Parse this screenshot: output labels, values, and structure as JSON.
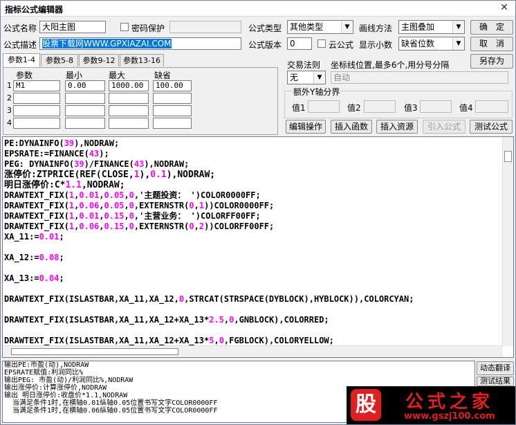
{
  "window": {
    "title": "指标公式编辑器",
    "close_glyph": "✕"
  },
  "form": {
    "name_label": "公式名称",
    "name_value": "大阳主图",
    "password_label": "密码保护",
    "password_value": "",
    "desc_label": "公式描述",
    "desc_value": "股票下载网WWW.GPXIAZAI.COM",
    "type_label": "公式类型",
    "type_value": "其他类型",
    "draw_label": "画线方法",
    "draw_value": "主图叠加",
    "version_label": "公式版本",
    "version_value": "0",
    "cloud_label": "云公式",
    "decimal_label": "显示小数",
    "decimal_value": "缺省位数",
    "trade_label": "交易法则",
    "trade_value": "无",
    "coord_label": "坐标线位置,最多6个,用分号分隔",
    "coord_value": "自动",
    "extra_y_label": "额外Y轴分界",
    "y_labels": [
      "值1",
      "值2",
      "值3",
      "值4"
    ]
  },
  "buttons": {
    "ok": "确　定",
    "cancel": "取　消",
    "save_as": "另存为",
    "edit_op": "编辑操作",
    "insert_func": "插入函数",
    "insert_res": "插入资源",
    "import_formula": "引入公式",
    "test_formula": "测试公式",
    "dyn_translate": "动态翻译",
    "test_result": "测试结果"
  },
  "tabs": [
    "参数1-4",
    "参数5-8",
    "参数9-12",
    "参数13-16"
  ],
  "params": {
    "headers": [
      "参数",
      "最小",
      "最大",
      "缺省"
    ],
    "rows": [
      {
        "idx": "1",
        "name": "M1",
        "min": "0.00",
        "max": "1000.00",
        "def": "100.00"
      },
      {
        "idx": "2",
        "name": "",
        "min": "",
        "max": "",
        "def": ""
      },
      {
        "idx": "3",
        "name": "",
        "min": "",
        "max": "",
        "def": ""
      },
      {
        "idx": "4",
        "name": "",
        "min": "",
        "max": "",
        "def": ""
      }
    ]
  },
  "code": {
    "l1": "PE:DYNAINFO(39),NODRAW;",
    "l2": "EPSRATE:=FINANCE(43);",
    "l3": "PEG: DYNAINFO(39)/FINANCE(43),NODRAW;",
    "l4": "涨停价:ZTPRICE(REF(CLOSE,1),0.1),NODRAW;",
    "l5": "明日涨停价:C*1.1,NODRAW;",
    "l6": "DRAWTEXT_FIX(1,0.01,0.05,0,'主题投资： ')COLOR0000FF;",
    "l7": "DRAWTEXT_FIX(1,0.06,0.05,0,EXTERNSTR(0,1))COLOR0000FF;",
    "l8": "DRAWTEXT_FIX(1,0.01,0.15,0,'主营业务： ')COLORFF00FF;",
    "l9": "DRAWTEXT_FIX(1,0.06,0.15,0,EXTERNSTR(0,2))COLORFF00FF;",
    "l10": "XA_11:=0.01;",
    "l11": "XA_12:=0.08;",
    "l12": "XA_13:=0.04;",
    "l13": "DRAWTEXT_FIX(ISLASTBAR,XA_11,XA_12,0,STRCAT(STRSPACE(DYBLOCK),HYBLOCK)),COLORCYAN;",
    "l14": "DRAWTEXT_FIX(ISLASTBAR,XA_11,XA_12+XA_13*2.5,0,GNBLOCK),COLORRED;",
    "l15": "DRAWTEXT_FIX(ISLASTBAR,XA_11,XA_12+XA_13*5,0,FGBLOCK),COLORYELLOW;"
  },
  "output": [
    "输出PE:市盈(动),NODRAW",
    "EPSRATE赋值:利润同比%",
    "输出PEG: 市盈(动)/利润同比%,NODRAW",
    "输出涨停价:计算涨停价,NODRAW",
    "输出 明日涨停价:收盘价*1.1,NODRAW",
    "  当满足条件1时,在横轴0.01纵轴0.05位置书写文字COLOR0000FF",
    "  当满足条件1时,在横轴0.06纵轴0.05位置书写文字COLOR0000FF"
  ],
  "watermark": {
    "badge": "股",
    "text": "公式之家",
    "url": "www.gszj100.com"
  },
  "colors": {
    "code_fn": "#008000",
    "code_num": "#ff00ff",
    "selection": "#0078d7",
    "logo_red": "#e02020"
  }
}
